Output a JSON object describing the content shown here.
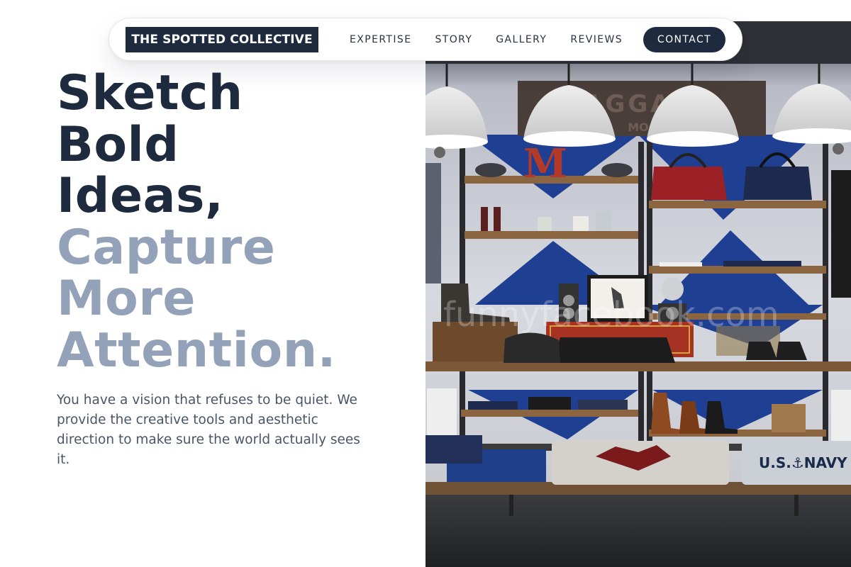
{
  "brand": {
    "logo_text": "THE SPOTTED COLLECTIVE"
  },
  "nav": {
    "links": [
      {
        "label": "EXPERTISE"
      },
      {
        "label": "STORY"
      },
      {
        "label": "GALLERY"
      },
      {
        "label": "REVIEWS"
      }
    ],
    "contact_label": "CONTACT"
  },
  "hero": {
    "headline_dark": [
      "Sketch",
      "Bold",
      "Ideas,"
    ],
    "headline_light": [
      "Capture",
      "More",
      "Attention."
    ],
    "description": "You have a vision that refuses to be quiet. We provide the creative tools and aesthetic direction to make sure the world actually sees it.",
    "image": {
      "sign_text": "BAGGAGE",
      "sign_subtext": "MO",
      "letter": "M",
      "blanket_text": "U.S.⚓NAVY",
      "watermark": "funnyfacebook.com"
    }
  },
  "colors": {
    "primary": "#1e2a3e",
    "muted_headline": "#93a2b8",
    "body_text": "#4a5568",
    "background": "#ffffff"
  }
}
